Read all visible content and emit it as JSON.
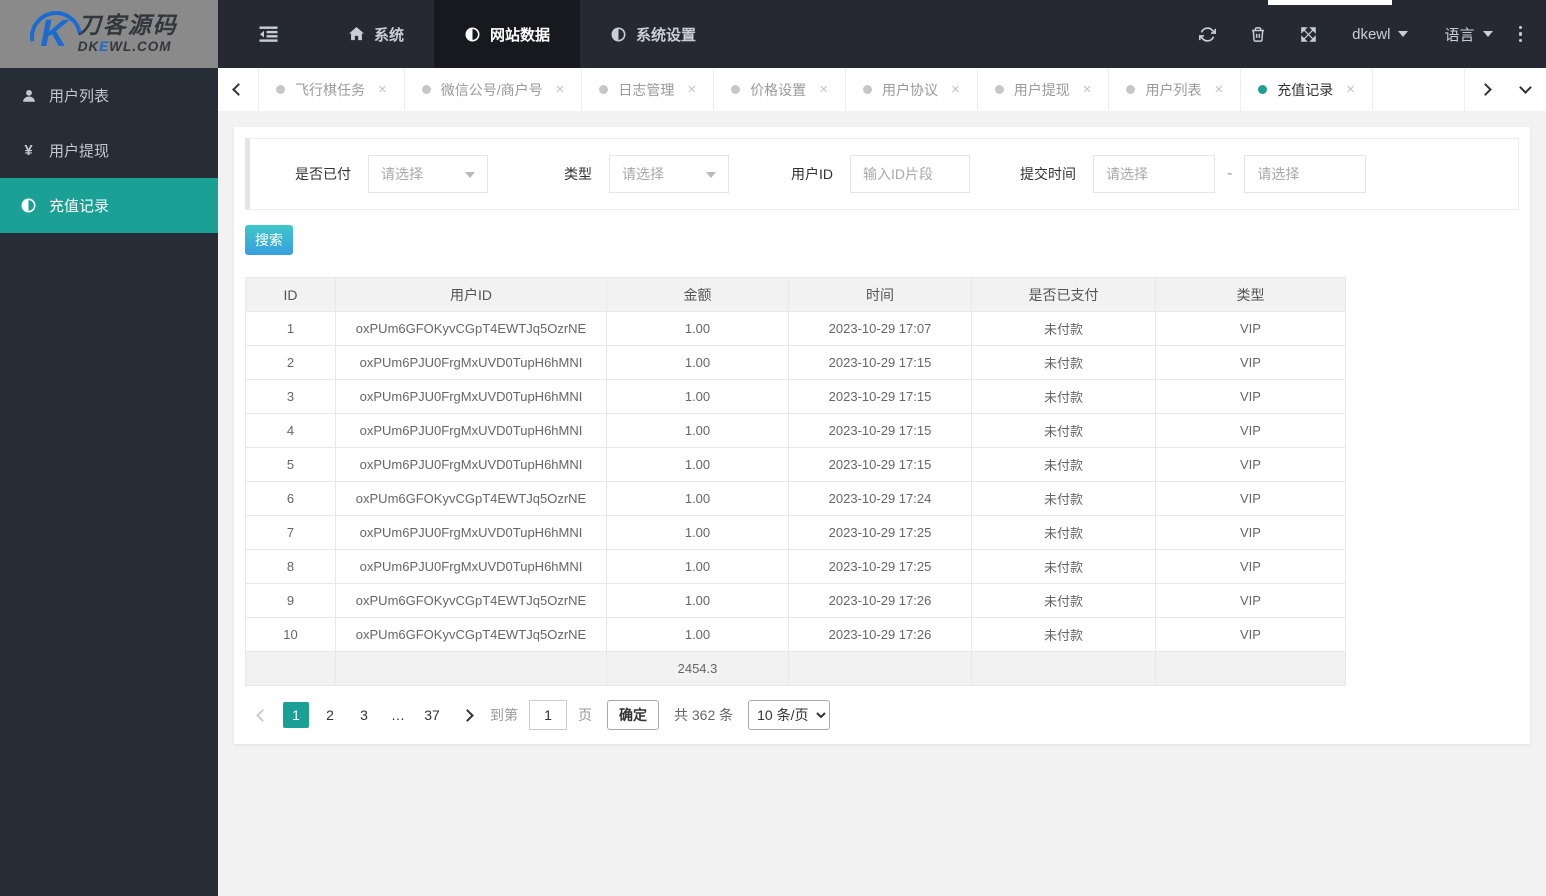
{
  "brand": {
    "name": "刀客源码",
    "mark_letter": "K",
    "domain_prefix": "DK",
    "domain_accent": "E",
    "domain_suffix": "WL.COM"
  },
  "icons": {
    "yen_glyph": "¥",
    "close_glyph": "×",
    "dash": "-"
  },
  "navbar": {
    "menu": [
      {
        "label": "系统",
        "icon": "home-icon",
        "active": false
      },
      {
        "label": "网站数据",
        "icon": "adjust-icon",
        "active": true
      },
      {
        "label": "系统设置",
        "icon": "adjust-icon",
        "active": false
      }
    ],
    "username": "dkewl",
    "language": "语言"
  },
  "sidebar": {
    "items": [
      {
        "label": "用户列表",
        "icon": "user-icon",
        "active": false
      },
      {
        "label": "用户提现",
        "icon": "yen-icon",
        "active": false
      },
      {
        "label": "充值记录",
        "icon": "adjust-icon",
        "active": true
      }
    ]
  },
  "tabbar": {
    "tabs": [
      {
        "label": "飞行棋任务",
        "active": false
      },
      {
        "label": "微信公号/商户号",
        "active": false
      },
      {
        "label": "日志管理",
        "active": false
      },
      {
        "label": "价格设置",
        "active": false
      },
      {
        "label": "用户协议",
        "active": false
      },
      {
        "label": "用户提现",
        "active": false
      },
      {
        "label": "用户列表",
        "active": false
      },
      {
        "label": "充值记录",
        "active": true
      }
    ]
  },
  "filters": {
    "paid_label": "是否已付",
    "paid_value": "请选择",
    "type_label": "类型",
    "type_value": "请选择",
    "userid_label": "用户ID",
    "userid_placeholder": "输入ID片段",
    "time_label": "提交时间",
    "time_from_placeholder": "请选择",
    "time_to_placeholder": "请选择",
    "search_label": "搜索"
  },
  "table": {
    "columns": [
      "ID",
      "用户ID",
      "金额",
      "时间",
      "是否已支付",
      "类型"
    ],
    "rows": [
      [
        "1",
        "oxPUm6GFOKyvCGpT4EWTJq5OzrNE",
        "1.00",
        "2023-10-29 17:07",
        "未付款",
        "VIP"
      ],
      [
        "2",
        "oxPUm6PJU0FrgMxUVD0TupH6hMNI",
        "1.00",
        "2023-10-29 17:15",
        "未付款",
        "VIP"
      ],
      [
        "3",
        "oxPUm6PJU0FrgMxUVD0TupH6hMNI",
        "1.00",
        "2023-10-29 17:15",
        "未付款",
        "VIP"
      ],
      [
        "4",
        "oxPUm6PJU0FrgMxUVD0TupH6hMNI",
        "1.00",
        "2023-10-29 17:15",
        "未付款",
        "VIP"
      ],
      [
        "5",
        "oxPUm6PJU0FrgMxUVD0TupH6hMNI",
        "1.00",
        "2023-10-29 17:15",
        "未付款",
        "VIP"
      ],
      [
        "6",
        "oxPUm6GFOKyvCGpT4EWTJq5OzrNE",
        "1.00",
        "2023-10-29 17:24",
        "未付款",
        "VIP"
      ],
      [
        "7",
        "oxPUm6PJU0FrgMxUVD0TupH6hMNI",
        "1.00",
        "2023-10-29 17:25",
        "未付款",
        "VIP"
      ],
      [
        "8",
        "oxPUm6PJU0FrgMxUVD0TupH6hMNI",
        "1.00",
        "2023-10-29 17:25",
        "未付款",
        "VIP"
      ],
      [
        "9",
        "oxPUm6GFOKyvCGpT4EWTJq5OzrNE",
        "1.00",
        "2023-10-29 17:26",
        "未付款",
        "VIP"
      ],
      [
        "10",
        "oxPUm6GFOKyvCGpT4EWTJq5OzrNE",
        "1.00",
        "2023-10-29 17:26",
        "未付款",
        "VIP"
      ]
    ],
    "total_amount": "2454.3"
  },
  "pagination": {
    "pages": [
      {
        "label": "1",
        "active": true
      },
      {
        "label": "2",
        "active": false
      },
      {
        "label": "3",
        "active": false
      },
      {
        "label": "…",
        "active": false
      },
      {
        "label": "37",
        "active": false
      }
    ],
    "goto_label": "到第",
    "goto_value": "1",
    "page_unit": "页",
    "confirm_label": "确定",
    "total_text": "共 362 条",
    "page_size_option": "10 条/页"
  },
  "colors": {
    "accent_teal": "#1aa094",
    "brand_blue": "#1c6bd0",
    "search_gradient_start": "#40c6c6",
    "search_gradient_end": "#389fe0",
    "navbar_bg": "#262932",
    "sidebar_bg": "#272d36"
  }
}
